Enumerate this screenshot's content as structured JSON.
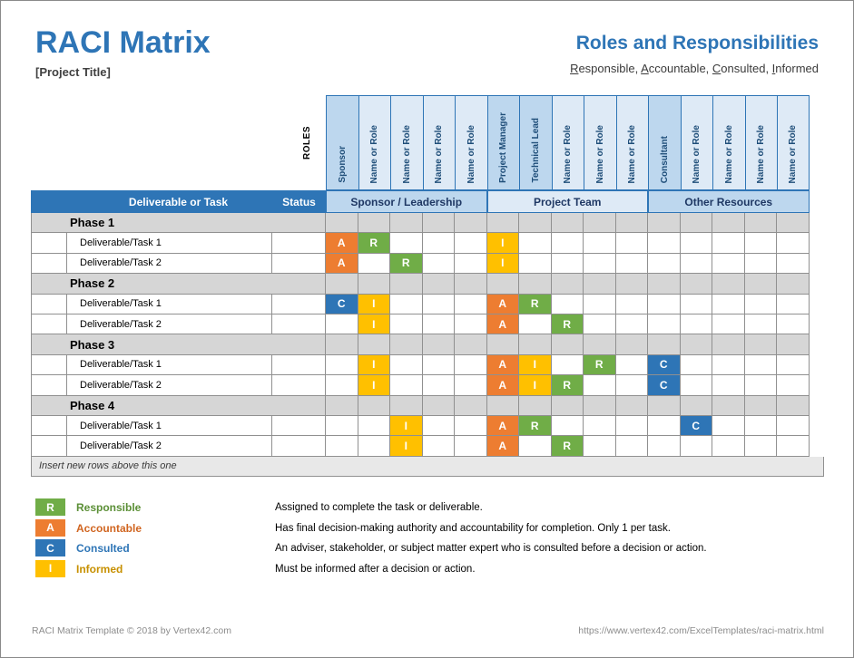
{
  "header": {
    "main_title": "RACI Matrix",
    "project_title": "[Project Title]",
    "right_title": "Roles and Responsibilities",
    "right_subtitle_parts": [
      {
        "u": "R",
        "rest": "esponsible, "
      },
      {
        "u": "A",
        "rest": "ccountable, "
      },
      {
        "u": "C",
        "rest": "onsulted, "
      },
      {
        "u": "I",
        "rest": "nformed"
      }
    ]
  },
  "matrix": {
    "roles_label": "ROLES",
    "task_column_header": "Deliverable or Task",
    "status_column_header": "Status",
    "groups": [
      {
        "label": "Sponsor / Leadership",
        "span": 5
      },
      {
        "label": "Project Team",
        "span": 5
      },
      {
        "label": "Other Resources",
        "span": 5
      }
    ],
    "role_columns": [
      {
        "label": "Sponsor",
        "named": true
      },
      {
        "label": "Name or Role",
        "named": false
      },
      {
        "label": "Name or Role",
        "named": false
      },
      {
        "label": "Name or Role",
        "named": false
      },
      {
        "label": "Name or Role",
        "named": false
      },
      {
        "label": "Project Manager",
        "named": true
      },
      {
        "label": "Technical Lead",
        "named": true
      },
      {
        "label": "Name or Role",
        "named": false
      },
      {
        "label": "Name or Role",
        "named": false
      },
      {
        "label": "Name or Role",
        "named": false
      },
      {
        "label": "Consultant",
        "named": true
      },
      {
        "label": "Name or Role",
        "named": false
      },
      {
        "label": "Name or Role",
        "named": false
      },
      {
        "label": "Name or Role",
        "named": false
      },
      {
        "label": "Name or Role",
        "named": false
      }
    ],
    "rows": [
      {
        "type": "phase",
        "label": "Phase 1"
      },
      {
        "type": "task",
        "label": "Deliverable/Task 1",
        "status": "",
        "assignments": {
          "0": "A",
          "1": "R",
          "5": "I"
        }
      },
      {
        "type": "task",
        "label": "Deliverable/Task 2",
        "status": "",
        "assignments": {
          "0": "A",
          "2": "R",
          "5": "I"
        }
      },
      {
        "type": "phase",
        "label": "Phase 2"
      },
      {
        "type": "task",
        "label": "Deliverable/Task 1",
        "status": "",
        "assignments": {
          "0": "C",
          "1": "I",
          "5": "A",
          "6": "R"
        }
      },
      {
        "type": "task",
        "label": "Deliverable/Task 2",
        "status": "",
        "assignments": {
          "1": "I",
          "5": "A",
          "7": "R"
        }
      },
      {
        "type": "phase",
        "label": "Phase 3"
      },
      {
        "type": "task",
        "label": "Deliverable/Task 1",
        "status": "",
        "assignments": {
          "1": "I",
          "5": "A",
          "6": "I",
          "8": "R",
          "10": "C"
        }
      },
      {
        "type": "task",
        "label": "Deliverable/Task 2",
        "status": "",
        "assignments": {
          "1": "I",
          "5": "A",
          "6": "I",
          "7": "R",
          "10": "C"
        }
      },
      {
        "type": "phase",
        "label": "Phase 4"
      },
      {
        "type": "task",
        "label": "Deliverable/Task 1",
        "status": "",
        "assignments": {
          "2": "I",
          "5": "A",
          "6": "R",
          "11": "C"
        }
      },
      {
        "type": "task",
        "label": "Deliverable/Task 2",
        "status": "",
        "assignments": {
          "2": "I",
          "5": "A",
          "7": "R"
        }
      }
    ],
    "insert_row_note": "Insert new rows above this one"
  },
  "legend": [
    {
      "key": "R",
      "name": "Responsible",
      "desc": "Assigned to complete the task or deliverable."
    },
    {
      "key": "A",
      "name": "Accountable",
      "desc": "Has final decision-making authority and accountability for completion. Only 1 per task."
    },
    {
      "key": "C",
      "name": "Consulted",
      "desc": "An adviser, stakeholder, or subject matter expert who is consulted before a decision or action."
    },
    {
      "key": "I",
      "name": "Informed",
      "desc": "Must be informed after a decision or action."
    }
  ],
  "footer": {
    "left": "RACI Matrix Template © 2018 by Vertex42.com",
    "right": "https://www.vertex42.com/ExcelTemplates/raci-matrix.html"
  },
  "colors": {
    "responsible": "#70AD47",
    "accountable": "#ED7D31",
    "consulted": "#2E75B6",
    "informed": "#FFC000",
    "brand_blue": "#2E75B6",
    "header_band": "#2E75B6",
    "col_named": "#BDD7EE",
    "col_generic": "#DEEAF6",
    "phase_band": "#D6D6D6"
  }
}
